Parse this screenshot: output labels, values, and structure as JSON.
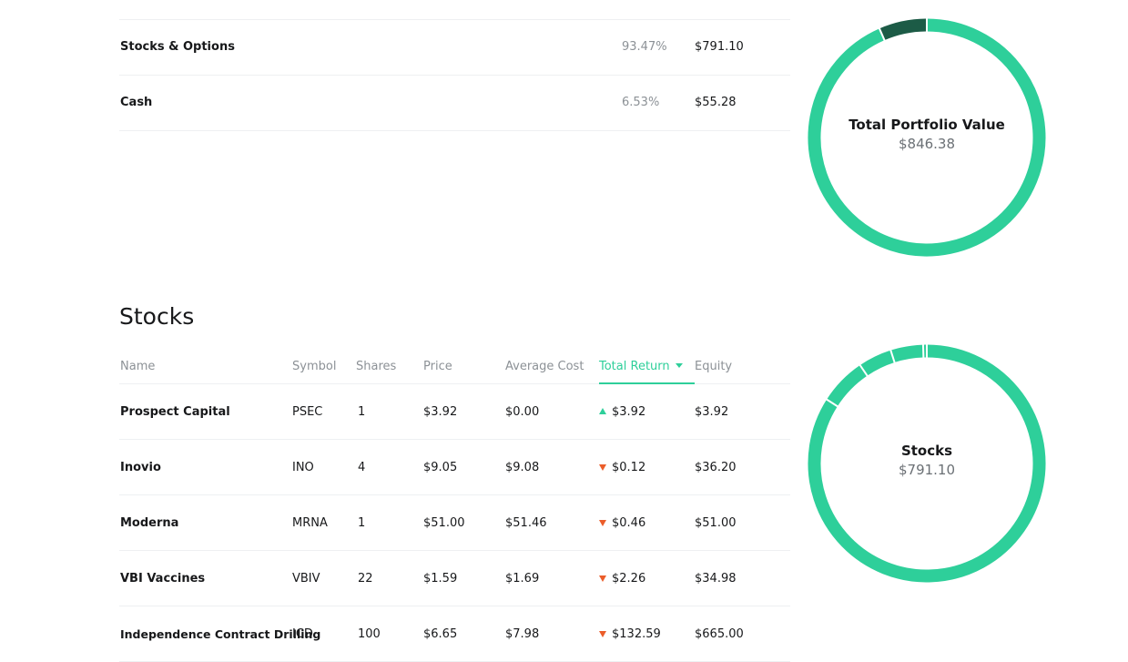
{
  "summary": {
    "rows": [
      {
        "name": "Stocks & Options",
        "percent": "93.47%",
        "value": "$791.10"
      },
      {
        "name": "Cash",
        "percent": "6.53%",
        "value": "$55.28"
      }
    ]
  },
  "portfolio_donut": {
    "title": "Total Portfolio Value",
    "value": "$846.38",
    "segments": [
      {
        "label": "Stocks & Options",
        "fraction": 0.9347,
        "color": "#2ecf9a"
      },
      {
        "label": "Cash",
        "fraction": 0.0653,
        "color": "#1c5b46"
      }
    ]
  },
  "stocks": {
    "title": "Stocks",
    "headers": {
      "name": "Name",
      "symbol": "Symbol",
      "shares": "Shares",
      "price": "Price",
      "average_cost": "Average Cost",
      "total_return": "Total Return",
      "equity": "Equity"
    },
    "rows": [
      {
        "name": "Prospect Capital",
        "symbol": "PSEC",
        "shares": "1",
        "price": "$3.92",
        "average_cost": "$0.00",
        "total_return": "$3.92",
        "direction": "up",
        "equity": "$3.92"
      },
      {
        "name": "Inovio",
        "symbol": "INO",
        "shares": "4",
        "price": "$9.05",
        "average_cost": "$9.08",
        "total_return": "$0.12",
        "direction": "down",
        "equity": "$36.20"
      },
      {
        "name": "Moderna",
        "symbol": "MRNA",
        "shares": "1",
        "price": "$51.00",
        "average_cost": "$51.46",
        "total_return": "$0.46",
        "direction": "down",
        "equity": "$51.00"
      },
      {
        "name": "VBI Vaccines",
        "symbol": "VBIV",
        "shares": "22",
        "price": "$1.59",
        "average_cost": "$1.69",
        "total_return": "$2.26",
        "direction": "down",
        "equity": "$34.98"
      },
      {
        "name": "Independence Contract Drilling",
        "symbol": "ICD",
        "shares": "100",
        "price": "$6.65",
        "average_cost": "$7.98",
        "total_return": "$132.59",
        "direction": "down",
        "equity": "$665.00"
      }
    ]
  },
  "stocks_donut": {
    "title": "Stocks",
    "value": "$791.10",
    "color": "#2ecf9a",
    "segments": [
      {
        "label": "Independence Contract Drilling",
        "value": 665.0
      },
      {
        "label": "Moderna",
        "value": 51.0
      },
      {
        "label": "Inovio",
        "value": 36.2
      },
      {
        "label": "VBI Vaccines",
        "value": 34.98
      },
      {
        "label": "Prospect Capital",
        "value": 3.92
      }
    ]
  },
  "colors": {
    "accent": "#2ecf9a",
    "accent_dark": "#1c5b46",
    "negative": "#eb5d2a"
  }
}
